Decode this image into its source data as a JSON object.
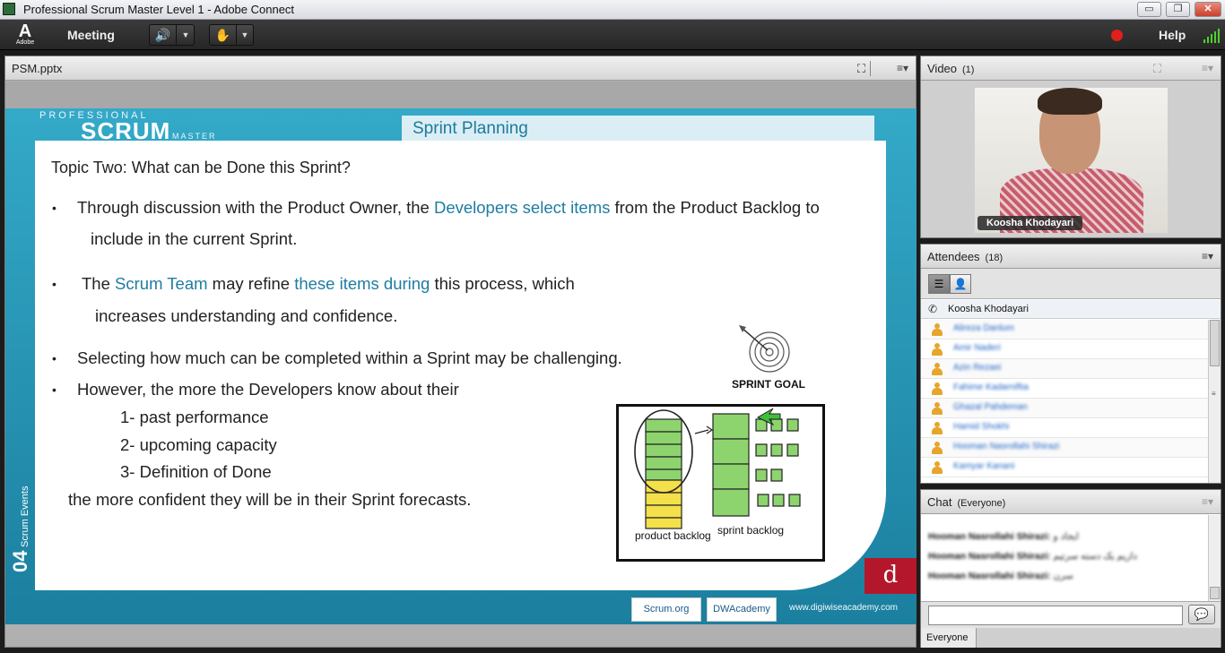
{
  "window": {
    "title": "Professional Scrum Master Level 1 - Adobe Connect",
    "controls": {
      "minimize": "▭",
      "restore": "❐",
      "close": "✕"
    }
  },
  "menubar": {
    "logo_text": "Adobe",
    "meeting_label": "Meeting",
    "speaker_icon": "speaker-icon",
    "raise_hand_icon": "raise-hand-icon",
    "help_label": "Help",
    "recording_color": "#e0201a"
  },
  "share_pod": {
    "title": "PSM.pptx",
    "menu": "≡▾",
    "fullscreen": "⛶"
  },
  "slide": {
    "brand_top": "PROFESSIONAL",
    "brand_main": "SCRUM",
    "brand_sub": "MASTER",
    "section_title": "Sprint Planning",
    "topic": "Topic Two: What can be Done this Sprint?",
    "bullet_char": "•",
    "b1_a": "Through discussion with the Product Owner, the ",
    "b1_hl": "Developers select items",
    "b1_b": " from the Product Backlog to",
    "b1_cont": "include in the current Sprint.",
    "b2_a": "The ",
    "b2_hl1": "Scrum Team",
    "b2_b": " may refine ",
    "b2_hl2": "these items during",
    "b2_c": " this process, which",
    "b2_cont": "increases understanding and confidence.",
    "b3": "Selecting how much can be completed within a Sprint may be challenging.",
    "b4": "However, the more the Developers know about their",
    "sub1": "1- past performance",
    "sub2": "2- upcoming capacity",
    "sub3": "3- Definition of Done",
    "conclusion": "the more confident they will be in their Sprint forecasts.",
    "sprint_goal_label": "SPRINT GOAL",
    "product_backlog_label": "product backlog",
    "sprint_backlog_label": "sprint backlog",
    "side_number": "04",
    "side_text": "Scrum Events",
    "logo_letter": "d",
    "footer_scrum": "Scrum.org",
    "footer_academy": "DWAcademy",
    "footer_url": "www.digiwiseacademy.com",
    "accent_color": "#1f7ca1"
  },
  "video_pod": {
    "title": "Video",
    "count": "(1)",
    "presenter_name": "Koosha Khodayari"
  },
  "attendees_pod": {
    "title": "Attendees",
    "count": "(18)",
    "host_name": "Koosha Khodayari",
    "attendees": [
      "Alireza Danlum",
      "Amir Naderi",
      "Azin Rezaei",
      "Fahime Kadarniftia",
      "Ghazal Pahdeman",
      "Hamid Shokhi",
      "Hooman Nasrollahi Shirazi",
      "Kamyar Kanani"
    ]
  },
  "chat_pod": {
    "title": "Chat",
    "scope": "(Everyone)",
    "messages": [
      {
        "sender": "Hooman Nasrollahi Shirazi:",
        "text": "ایجاد و"
      },
      {
        "sender": "Hooman Nasrollahi Shirazi:",
        "text": "داریم یک دسته سرتیم"
      },
      {
        "sender": "Hooman Nasrollahi Shirazi:",
        "text": "سرن"
      }
    ],
    "input_value": "",
    "tab_label": "Everyone"
  }
}
